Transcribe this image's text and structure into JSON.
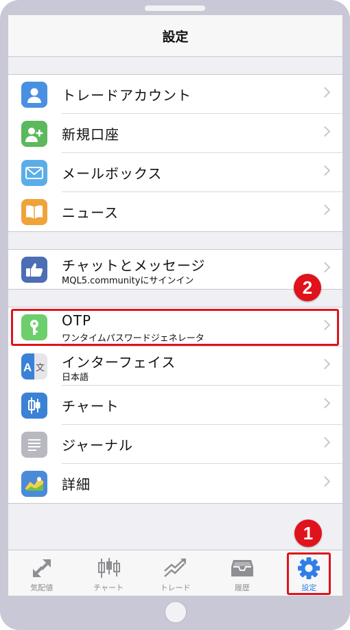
{
  "header": {
    "title": "設定"
  },
  "groups": [
    {
      "rows": [
        {
          "label": "トレードアカウント",
          "icon": "account-icon",
          "color": "#4a90e2"
        },
        {
          "label": "新規口座",
          "icon": "add-user-icon",
          "color": "#5cb85c"
        },
        {
          "label": "メールボックス",
          "icon": "mail-icon",
          "color": "#5aaee8"
        },
        {
          "label": "ニュース",
          "icon": "book-icon",
          "color": "#f0a33a"
        }
      ]
    },
    {
      "rows": [
        {
          "label": "チャットとメッセージ",
          "sub": "MQL5.communityにサインイン",
          "icon": "thumb-icon",
          "color": "#4b6eb5"
        }
      ]
    },
    {
      "rows": [
        {
          "label": "OTP",
          "sub": "ワンタイムパスワードジェネレータ",
          "icon": "key-icon",
          "color": "#6ccf6c"
        },
        {
          "label": "インターフェイス",
          "sub": "日本語",
          "icon": "translate-icon",
          "color": "#3b82d6"
        },
        {
          "label": "チャート",
          "icon": "candlestick-icon",
          "color": "#3b82d6"
        },
        {
          "label": "ジャーナル",
          "icon": "journal-icon",
          "color": "#b8b8c0"
        },
        {
          "label": "詳細",
          "icon": "about-icon",
          "color": "#4a8ad8"
        }
      ]
    }
  ],
  "tabbar": {
    "tabs": [
      {
        "label": "気配値",
        "icon": "quotes-icon"
      },
      {
        "label": "チャート",
        "icon": "chart-icon"
      },
      {
        "label": "トレード",
        "icon": "trade-icon"
      },
      {
        "label": "履歴",
        "icon": "history-icon"
      },
      {
        "label": "設定",
        "icon": "settings-icon",
        "active": true
      }
    ]
  },
  "annotations": {
    "badge1": "1",
    "badge2": "2"
  },
  "colors": {
    "accent": "#2f7ee8",
    "highlight": "#e0121b"
  }
}
